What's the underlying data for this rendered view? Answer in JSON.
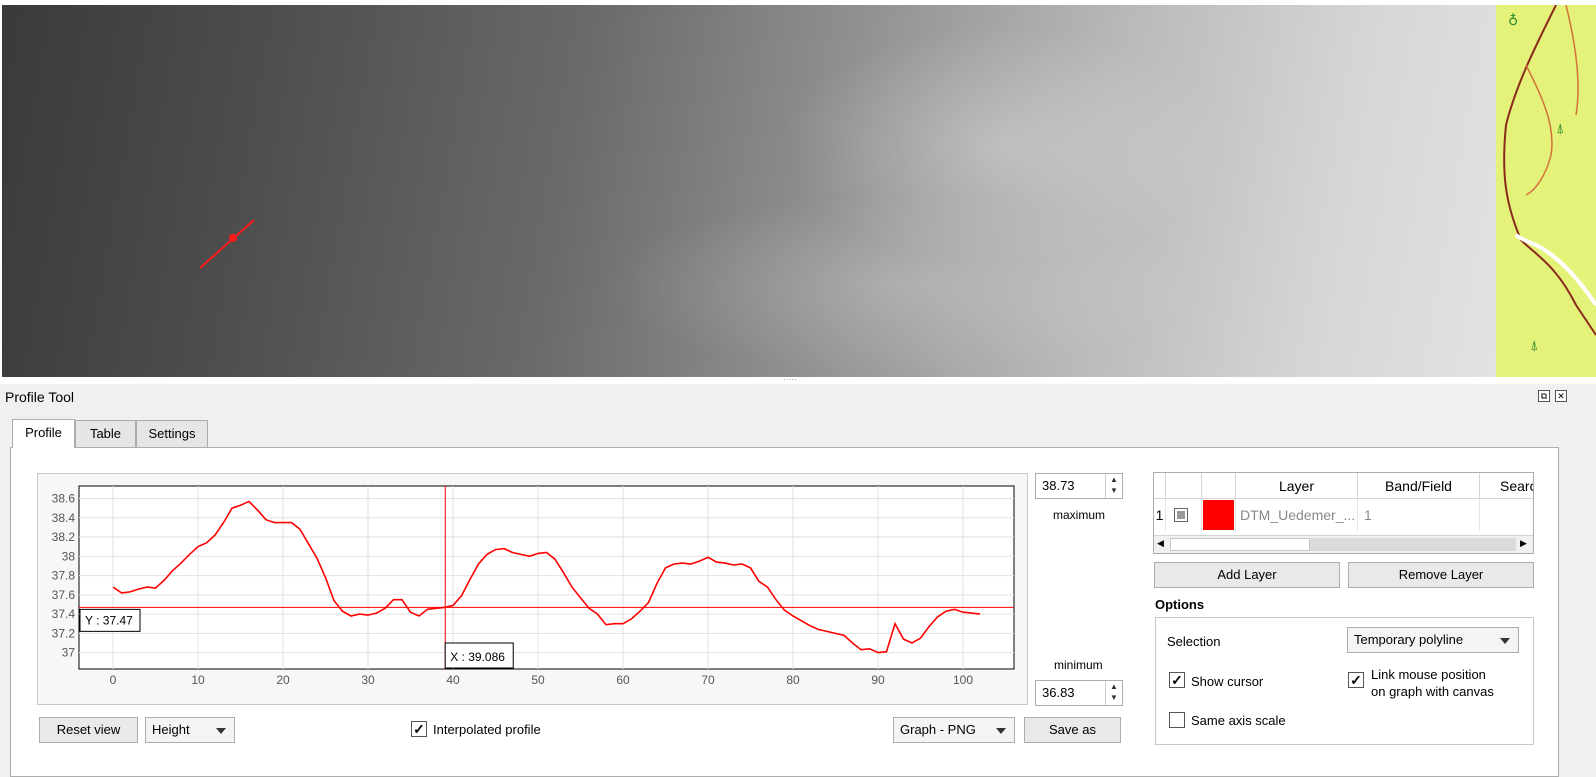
{
  "dock": {
    "title": "Profile Tool",
    "float_icon": "⧉",
    "close_icon": "✕"
  },
  "tabs": [
    {
      "label": "Profile",
      "active": true
    },
    {
      "label": "Table",
      "active": false
    },
    {
      "label": "Settings",
      "active": false
    }
  ],
  "plot": {
    "y_ticks": [
      "38.6",
      "38.4",
      "38.2",
      "38",
      "37.8",
      "37.6",
      "37.4",
      "37.2",
      "37"
    ],
    "x_ticks": [
      "0",
      "10",
      "20",
      "30",
      "40",
      "50",
      "60",
      "70",
      "80",
      "90",
      "100"
    ],
    "cursor_y_label": "Y : 37.47",
    "cursor_x_label": "X : 39.086",
    "cursor": {
      "x": 39.086,
      "y": 37.47
    },
    "line_color": "#ff0000"
  },
  "chart_data": {
    "type": "line",
    "xlim": [
      -4,
      106
    ],
    "ylim": [
      36.83,
      38.73
    ],
    "x_ticks": [
      0,
      10,
      20,
      30,
      40,
      50,
      60,
      70,
      80,
      90,
      100
    ],
    "y_ticks": [
      37,
      37.2,
      37.4,
      37.6,
      37.8,
      38,
      38.2,
      38.4,
      38.6
    ],
    "grid": true,
    "series": [
      {
        "x": [
          0,
          1,
          2,
          3,
          4,
          5,
          6,
          7,
          8,
          9,
          10,
          11,
          12,
          13,
          14,
          15,
          16,
          17,
          18,
          19,
          20,
          21,
          22,
          23,
          24,
          25,
          26,
          27,
          28,
          29,
          30,
          31,
          32,
          33,
          34,
          35,
          36,
          37,
          38,
          39,
          40,
          41,
          42,
          43,
          44,
          45,
          46,
          47,
          48,
          49,
          50,
          51,
          52,
          53,
          54,
          55,
          56,
          57,
          58,
          59,
          60,
          61,
          62,
          63,
          64,
          65,
          66,
          67,
          68,
          69,
          70,
          71,
          72,
          73,
          74,
          75,
          76,
          77,
          78,
          79,
          80,
          81,
          82,
          83,
          84,
          85,
          86,
          87,
          88,
          89,
          90,
          91,
          92,
          93,
          94,
          95,
          96,
          97,
          98,
          99,
          100,
          101,
          102
        ],
        "y": [
          37.68,
          37.62,
          37.63,
          37.66,
          37.68,
          37.67,
          37.75,
          37.85,
          37.93,
          38.02,
          38.1,
          38.14,
          38.22,
          38.35,
          38.5,
          38.53,
          38.57,
          38.48,
          38.38,
          38.35,
          38.35,
          38.35,
          38.28,
          38.13,
          37.98,
          37.78,
          37.54,
          37.43,
          37.38,
          37.4,
          37.39,
          37.41,
          37.46,
          37.55,
          37.55,
          37.42,
          37.38,
          37.45,
          37.46,
          37.47,
          37.49,
          37.59,
          37.76,
          37.92,
          38.02,
          38.07,
          38.08,
          38.04,
          38.02,
          38.0,
          38.03,
          38.04,
          37.97,
          37.83,
          37.68,
          37.57,
          37.46,
          37.4,
          37.29,
          37.3,
          37.3,
          37.35,
          37.43,
          37.52,
          37.72,
          37.88,
          37.92,
          37.93,
          37.92,
          37.95,
          37.99,
          37.94,
          37.93,
          37.91,
          37.92,
          37.88,
          37.74,
          37.68,
          37.55,
          37.44,
          37.38,
          37.33,
          37.28,
          37.24,
          37.22,
          37.2,
          37.18,
          37.1,
          37.03,
          37.04,
          37.0,
          37.01,
          37.3,
          37.14,
          37.1,
          37.15,
          37.27,
          37.37,
          37.43,
          37.45,
          37.42,
          37.41,
          37.4
        ]
      }
    ]
  },
  "range": {
    "maximum_value": "38.73",
    "maximum_label": "maximum",
    "minimum_label": "minimum",
    "minimum_value": "36.83"
  },
  "bottom_bar": {
    "reset_view": "Reset view",
    "height_combo": "Height",
    "interpolated_label": "Interpolated profile",
    "interpolated_checked": true,
    "export_combo": "Graph - PNG",
    "save_as": "Save as"
  },
  "layer_table": {
    "headers": [
      "Layer",
      "Band/Field",
      "Searc"
    ],
    "rows": [
      {
        "index": "1",
        "color": "#ff0000",
        "layer": "DTM_Uedemer_...",
        "band": "1"
      }
    ]
  },
  "buttons": {
    "add_layer": "Add Layer",
    "remove_layer": "Remove Layer"
  },
  "options": {
    "title": "Options",
    "selection_label": "Selection",
    "selection_value": "Temporary polyline",
    "show_cursor": "Show cursor",
    "show_cursor_checked": true,
    "link_mouse_line1": "Link mouse position",
    "link_mouse_line2": "on graph with canvas",
    "link_mouse_checked": true,
    "same_axis": "Same axis scale",
    "same_axis_checked": false,
    "check_mark": "✓"
  }
}
